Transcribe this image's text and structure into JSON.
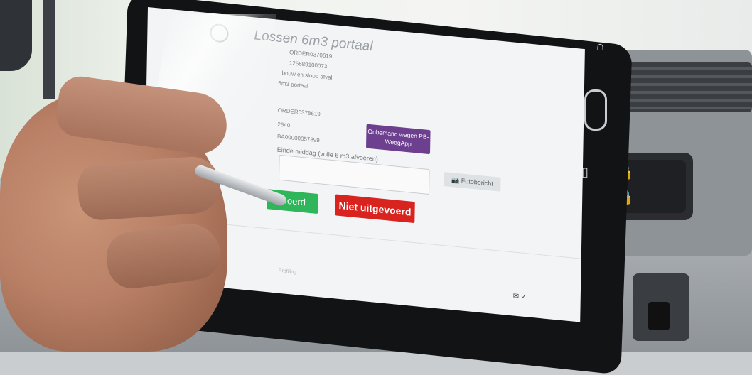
{
  "app": {
    "title": "Lossen 6m3 portaal",
    "details_top": [
      "ORDER0370619",
      "125689100073",
      "bouw en sloop afval",
      "6m3 portaal"
    ],
    "details_mid": [
      "ORDER0378619",
      "2640",
      "BA00000057899"
    ],
    "weigh_button": "Onbemand wegen PB-WeegApp",
    "remark_label": "Einde middag (volle 6 m3 afvoeren)",
    "photo_button": "Fotobericht",
    "done_button": "...oerd",
    "not_done_button": "Niet uitgevoerd",
    "footer": "Profiling",
    "status_icons": "✉ ✓"
  },
  "colors": {
    "purple": "#6d3f8f",
    "green": "#2fb55a",
    "red": "#d9231f"
  },
  "icons": [
    "camera-icon",
    "lock-icon",
    "unlock-icon",
    "home-button",
    "back-icon",
    "recent-apps-icon"
  ]
}
